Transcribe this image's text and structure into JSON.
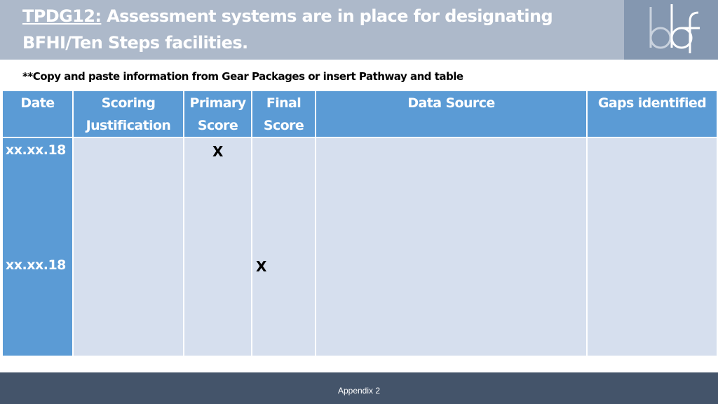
{
  "header": {
    "title_code": "TPDG12:",
    "title_text": " Assessment systems are in place for designating BFHI/Ten Steps facilities.",
    "logo_text": "bbf"
  },
  "instruction": "**Copy and paste information from Gear Packages or insert Pathway and table",
  "table": {
    "columns": [
      "Date",
      "Scoring Justification",
      "Primary Score",
      "Final Score",
      "Data Source",
      "Gaps identified"
    ],
    "rows": [
      {
        "date": "xx.xx.18",
        "primary_score": "X",
        "final_score": ""
      },
      {
        "date": "xx.xx.18",
        "primary_score": "",
        "final_score": "X"
      }
    ]
  },
  "footer": {
    "label": "Appendix 2"
  },
  "colors": {
    "header_bg": "#adb9ca",
    "logo_bg": "#8497b0",
    "table_header": "#5b9bd5",
    "table_cell": "#d6dfee",
    "footer_bg": "#44546a"
  }
}
